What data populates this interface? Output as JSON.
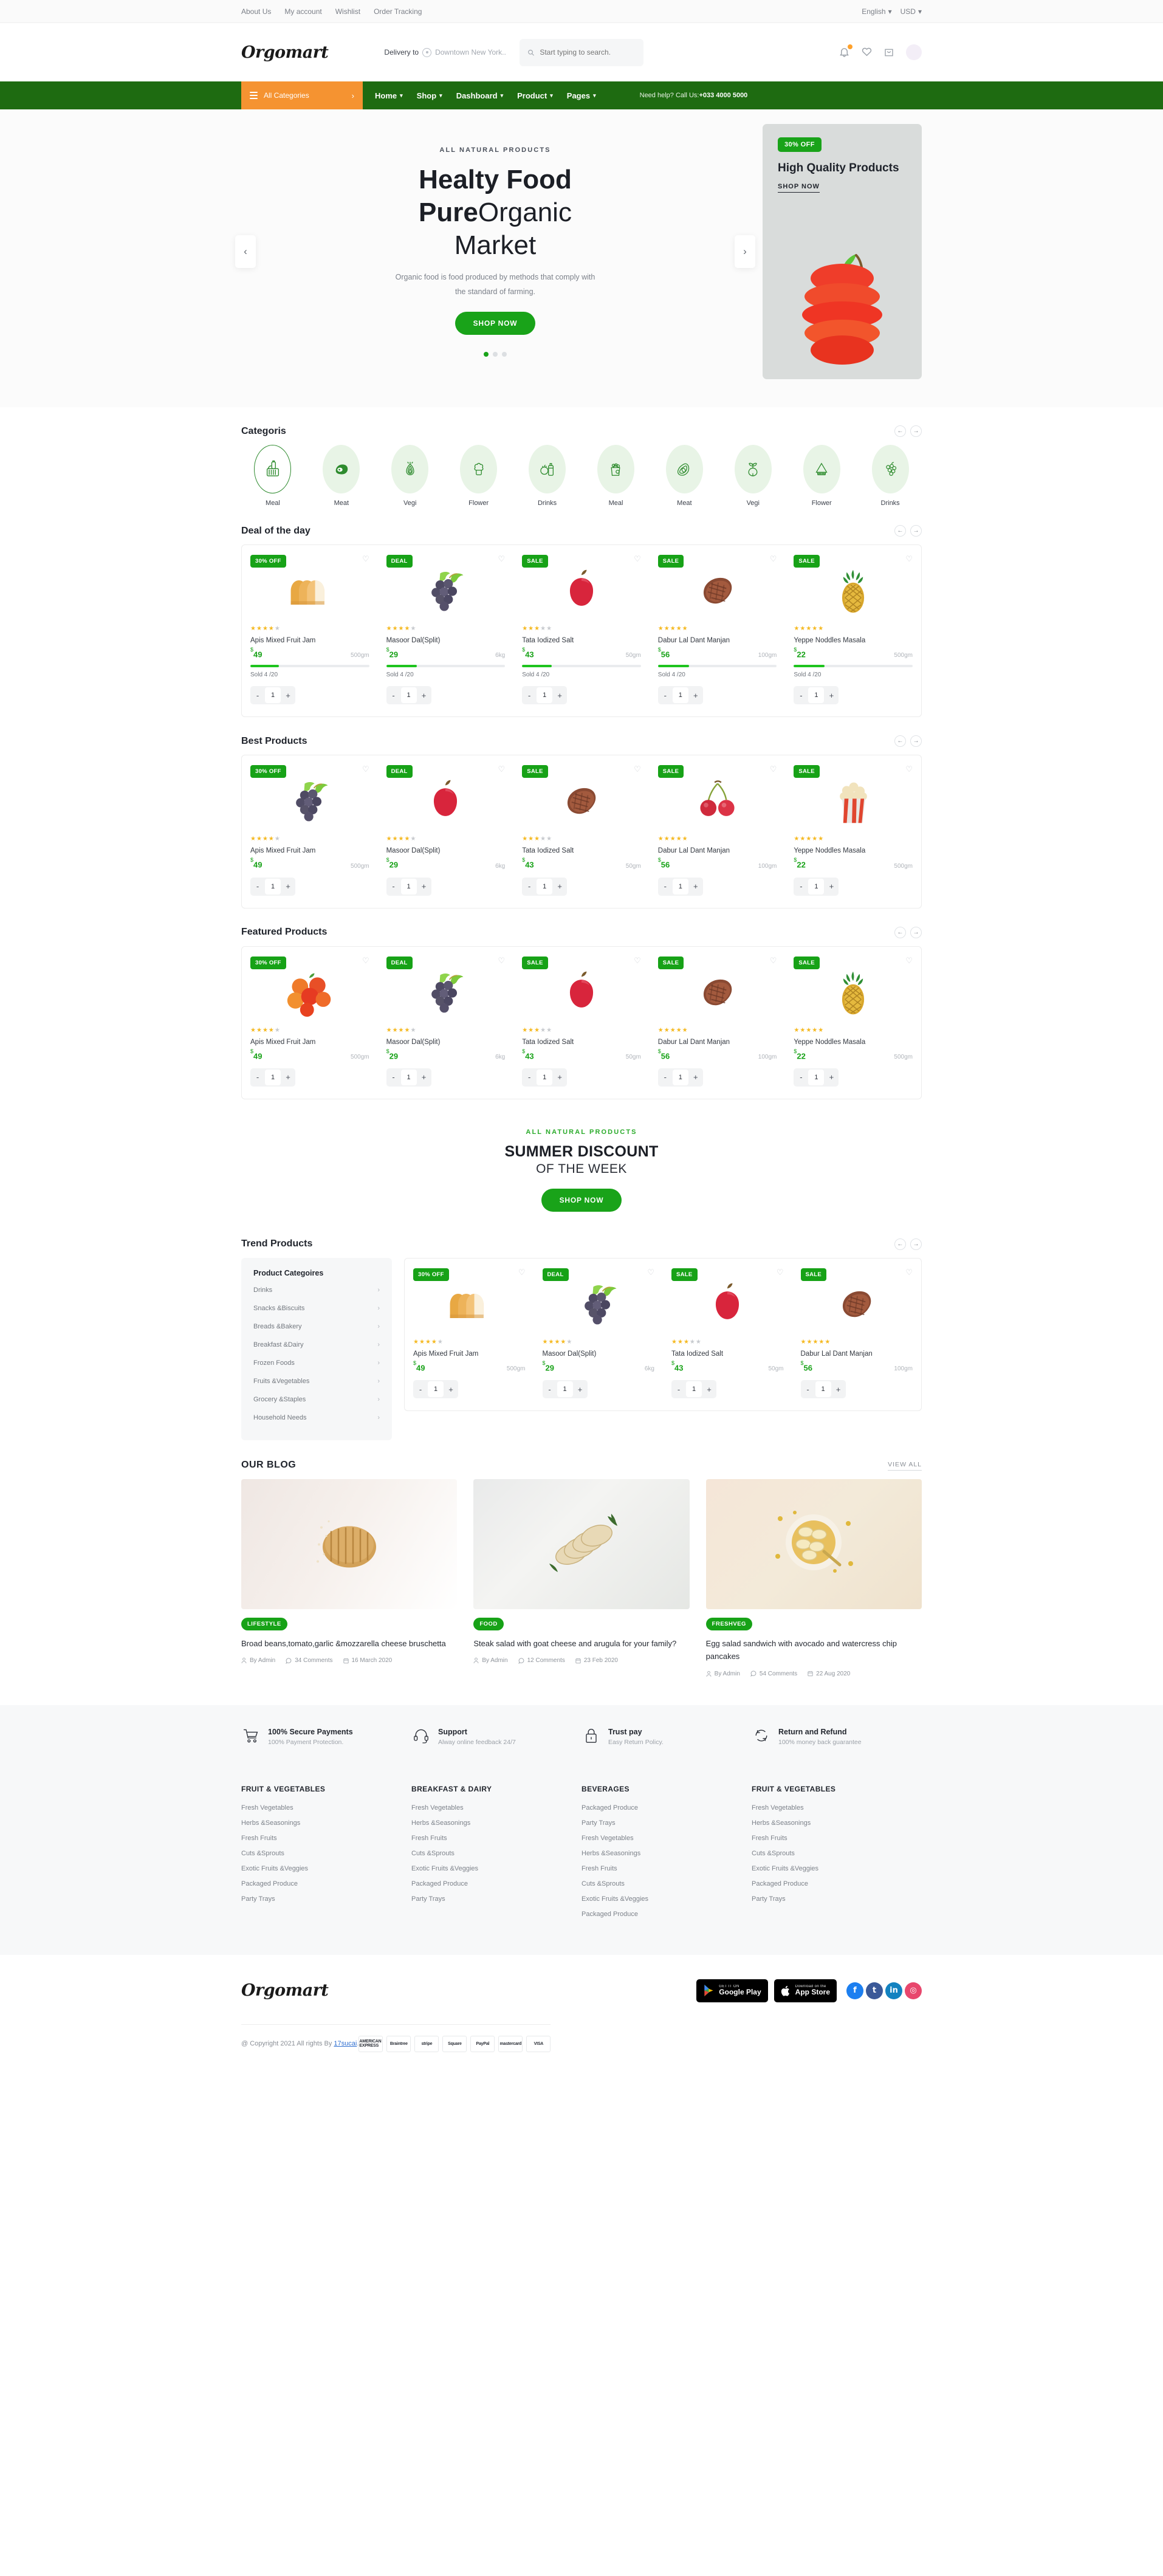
{
  "topbar": {
    "links": [
      "About Us",
      "My account",
      "Wishlist",
      "Order Tracking"
    ],
    "language": "English",
    "currency": "USD"
  },
  "header": {
    "logo": "Orgomart",
    "delivery_label": "Delivery to",
    "delivery_location": "Downtown New York..",
    "search_placeholder": "Start typing to search."
  },
  "nav": {
    "all_categories": "All Categories",
    "links": [
      "Home",
      "Shop",
      "Dashboard",
      "Product",
      "Pages"
    ],
    "help_text": "Need help? Call Us:",
    "help_phone": "+033 4000 5000"
  },
  "hero": {
    "eyebrow": "ALL NATURAL PRODUCTS",
    "line1": "Healty Food",
    "line2_bold": "Pure",
    "line2_rest": "Organic",
    "line3": "Market",
    "subtitle": "Organic food is food produced by methods that comply with the standard of farming.",
    "cta": "SHOP NOW",
    "dots": 3,
    "active_dot": 0,
    "promo": {
      "badge": "30% OFF",
      "title": "High Quality Products",
      "link": "SHOP NOW"
    }
  },
  "categories": {
    "title": "Categoris",
    "items": [
      {
        "label": "Meal",
        "icon": "basket-icon"
      },
      {
        "label": "Meat",
        "icon": "meat-icon"
      },
      {
        "label": "Vegi",
        "icon": "onion-icon"
      },
      {
        "label": "Flower",
        "icon": "broccoli-icon"
      },
      {
        "label": "Drinks",
        "icon": "bottle-icon"
      },
      {
        "label": "Meal",
        "icon": "grocery-bag-icon"
      },
      {
        "label": "Meat",
        "icon": "avocado-icon"
      },
      {
        "label": "Vegi",
        "icon": "beet-icon"
      },
      {
        "label": "Flower",
        "icon": "watermelon-icon"
      },
      {
        "label": "Drinks",
        "icon": "grapes-icon"
      }
    ]
  },
  "deal_of_the_day": {
    "title": "Deal of the day",
    "products": [
      {
        "tag": "30% OFF",
        "name": "Apis Mixed Fruit Jam",
        "price": "49",
        "currency": "$",
        "weight": "500gm",
        "rating": 4,
        "sold": "Sold 4 /20",
        "progress": 24,
        "qty": "1",
        "image": "bread-loaf"
      },
      {
        "tag": "DEAL",
        "name": "Masoor Dal(Split)",
        "price": "29",
        "currency": "$",
        "weight": "6kg",
        "rating": 4,
        "sold": "Sold 4 /20",
        "progress": 26,
        "qty": "1",
        "image": "grapes"
      },
      {
        "tag": "SALE",
        "name": "Tata Iodized Salt",
        "price": "43",
        "currency": "$",
        "weight": "50gm",
        "rating": 3,
        "sold": "Sold 4 /20",
        "progress": 25,
        "qty": "1",
        "image": "apple"
      },
      {
        "tag": "SALE",
        "name": "Dabur Lal Dant Manjan",
        "price": "56",
        "currency": "$",
        "weight": "100gm",
        "rating": 5,
        "sold": "Sold 4 /20",
        "progress": 26,
        "qty": "1",
        "image": "steak"
      },
      {
        "tag": "SALE",
        "name": "Yeppe Noddles Masala",
        "price": "22",
        "currency": "$",
        "weight": "500gm",
        "rating": 5,
        "sold": "Sold 4 /20",
        "progress": 26,
        "qty": "1",
        "image": "pineapple"
      }
    ]
  },
  "best_products": {
    "title": "Best Products",
    "products": [
      {
        "tag": "30% OFF",
        "name": "Apis Mixed Fruit Jam",
        "price": "49",
        "currency": "$",
        "weight": "500gm",
        "rating": 4,
        "qty": "1",
        "image": "grapes"
      },
      {
        "tag": "DEAL",
        "name": "Masoor Dal(Split)",
        "price": "29",
        "currency": "$",
        "weight": "6kg",
        "rating": 4,
        "qty": "1",
        "image": "apple"
      },
      {
        "tag": "SALE",
        "name": "Tata Iodized Salt",
        "price": "43",
        "currency": "$",
        "weight": "50gm",
        "rating": 3,
        "qty": "1",
        "image": "steak"
      },
      {
        "tag": "SALE",
        "name": "Dabur Lal Dant Manjan",
        "price": "56",
        "currency": "$",
        "weight": "100gm",
        "rating": 5,
        "qty": "1",
        "image": "cherry"
      },
      {
        "tag": "SALE",
        "name": "Yeppe Noddles Masala",
        "price": "22",
        "currency": "$",
        "weight": "500gm",
        "rating": 5,
        "qty": "1",
        "image": "popcorn"
      }
    ]
  },
  "featured_products": {
    "title": "Featured Products",
    "products": [
      {
        "tag": "30% OFF",
        "name": "Apis Mixed Fruit Jam",
        "price": "49",
        "currency": "$",
        "weight": "500gm",
        "rating": 4,
        "qty": "1",
        "image": "peaches"
      },
      {
        "tag": "DEAL",
        "name": "Masoor Dal(Split)",
        "price": "29",
        "currency": "$",
        "weight": "6kg",
        "rating": 4,
        "qty": "1",
        "image": "grapes"
      },
      {
        "tag": "SALE",
        "name": "Tata Iodized Salt",
        "price": "43",
        "currency": "$",
        "weight": "50gm",
        "rating": 3,
        "qty": "1",
        "image": "apple"
      },
      {
        "tag": "SALE",
        "name": "Dabur Lal Dant Manjan",
        "price": "56",
        "currency": "$",
        "weight": "100gm",
        "rating": 5,
        "qty": "1",
        "image": "steak"
      },
      {
        "tag": "SALE",
        "name": "Yeppe Noddles Masala",
        "price": "22",
        "currency": "$",
        "weight": "500gm",
        "rating": 5,
        "qty": "1",
        "image": "pineapple"
      }
    ]
  },
  "discount_banner": {
    "eyebrow": "ALL NATURAL PRODUCTS",
    "line1": "SUMMER DISCOUNT",
    "line2": "OF THE WEEK",
    "cta": "SHOP NOW"
  },
  "trend": {
    "title": "Trend Products",
    "panel_title": "Product Categoires",
    "panel_items": [
      "Drinks",
      "Snacks &Biscuits",
      "Breads &Bakery",
      "Breakfast &Dairy",
      "Frozen Foods",
      "Fruits &Vegetables",
      "Grocery &Staples",
      "Household Needs"
    ],
    "products": [
      {
        "tag": "30% OFF",
        "name": "Apis Mixed Fruit Jam",
        "price": "49",
        "currency": "$",
        "weight": "500gm",
        "rating": 4,
        "qty": "1",
        "image": "bread-loaf"
      },
      {
        "tag": "DEAL",
        "name": "Masoor Dal(Split)",
        "price": "29",
        "currency": "$",
        "weight": "6kg",
        "rating": 4,
        "qty": "1",
        "image": "grapes"
      },
      {
        "tag": "SALE",
        "name": "Tata Iodized Salt",
        "price": "43",
        "currency": "$",
        "weight": "50gm",
        "rating": 3,
        "qty": "1",
        "image": "apple"
      },
      {
        "tag": "SALE",
        "name": "Dabur Lal Dant Manjan",
        "price": "56",
        "currency": "$",
        "weight": "100gm",
        "rating": 5,
        "qty": "1",
        "image": "steak"
      }
    ]
  },
  "blog": {
    "title": "OUR BLOG",
    "view_all": "VIEW ALL",
    "posts": [
      {
        "tag": "LIFESTYLE",
        "title": "Broad beans,tomato,garlic &mozzarella cheese bruschetta",
        "author": "By Admin",
        "comments": "34 Comments",
        "date": "16 March 2020"
      },
      {
        "tag": "FOOD",
        "title": "Steak salad with goat cheese and arugula for your family?",
        "author": "By Admin",
        "comments": "12 Comments",
        "date": "23 Feb 2020"
      },
      {
        "tag": "FRESHVEG",
        "title": "Egg salad sandwich with avocado and watercress chip pancakes",
        "author": "By Admin",
        "comments": "54 Comments",
        "date": "22 Aug 2020"
      }
    ]
  },
  "services": [
    {
      "icon": "cart-icon",
      "title": "100% Secure Payments",
      "subtitle": "100% Payment Protection."
    },
    {
      "icon": "headset-icon",
      "title": "Support",
      "subtitle": "Alway online feedback 24/7"
    },
    {
      "icon": "lock-icon",
      "title": "Trust pay",
      "subtitle": "Easy Return Policy."
    },
    {
      "icon": "return-icon",
      "title": "Return and Refund",
      "subtitle": "100% money back guarantee"
    }
  ],
  "footer_columns": [
    {
      "title": "FRUIT & VEGETABLES",
      "links": [
        "Fresh Vegetables",
        "Herbs &Seasonings",
        "Fresh Fruits",
        "Cuts &Sprouts",
        "Exotic Fruits &Veggies",
        "Packaged Produce",
        "Party Trays"
      ]
    },
    {
      "title": "BREAKFAST & DAIRY",
      "links": [
        "Fresh Vegetables",
        "Herbs &Seasonings",
        "Fresh Fruits",
        "Cuts &Sprouts",
        "Exotic Fruits &Veggies",
        "Packaged Produce",
        "Party Trays"
      ]
    },
    {
      "title": "BEVERAGES",
      "links": [
        "Packaged Produce",
        "Party Trays",
        "Fresh Vegetables",
        "Herbs &Seasonings",
        "Fresh Fruits",
        "Cuts &Sprouts",
        "Exotic Fruits &Veggies",
        "Packaged Produce"
      ]
    },
    {
      "title": "FRUIT & VEGETABLES",
      "links": [
        "Fresh Vegetables",
        "Herbs &Seasonings",
        "Fresh Fruits",
        "Cuts &Sprouts",
        "Exotic Fruits &Veggies",
        "Packaged Produce",
        "Party Trays"
      ]
    }
  ],
  "footer_bottom": {
    "logo": "Orgomart",
    "google_play_top": "GET IT ON",
    "google_play_bot": "Google Play",
    "app_store_top": "Download on the",
    "app_store_bot": "App Store",
    "socials": [
      {
        "name": "facebook-icon",
        "glyph": "f",
        "color": "#1c7ff0"
      },
      {
        "name": "twitter-icon",
        "glyph": "t",
        "color": "#3b5998"
      },
      {
        "name": "linkedin-icon",
        "glyph": "in",
        "color": "#1382c0"
      },
      {
        "name": "instagram-icon",
        "glyph": "◎",
        "color": "#e8476d"
      }
    ],
    "copyright_pre": "@ Copyright 2021 All rights By ",
    "copyright_link": "17sucai",
    "copyright_post": ".",
    "payments": [
      "AMERICAN EXPRESS",
      "Braintree",
      "stripe",
      "Square",
      "PayPal",
      "mastercard",
      "VISA"
    ]
  },
  "colors": {
    "brand_green": "#19a319",
    "nav_green": "#1e6b11",
    "accent_orange": "#f59331",
    "star_gold": "#f5b921"
  }
}
